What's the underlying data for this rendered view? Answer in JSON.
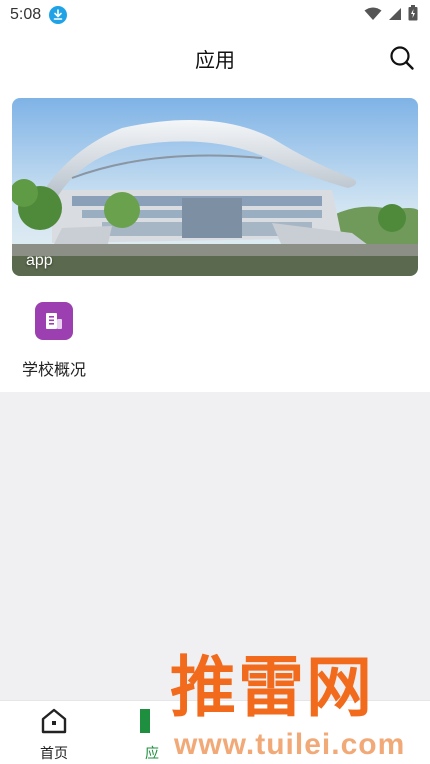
{
  "status_bar": {
    "time": "5:08",
    "icons": [
      "download-icon",
      "wifi-icon",
      "signal-icon",
      "battery-icon"
    ]
  },
  "header": {
    "title": "应用",
    "search_icon": "search-icon"
  },
  "banner": {
    "caption": "app"
  },
  "apps": [
    {
      "label": "学校概况",
      "icon": "building-icon",
      "icon_color": "#9c3fb0"
    }
  ],
  "bottom_nav": {
    "items": [
      {
        "label": "首页",
        "icon": "home-icon",
        "active": false
      },
      {
        "label": "应",
        "icon": "apps-icon",
        "active": true
      }
    ],
    "active_color": "#1e8f3e"
  },
  "watermark": {
    "main": "推雷网",
    "url": "www.tuilei.com"
  }
}
